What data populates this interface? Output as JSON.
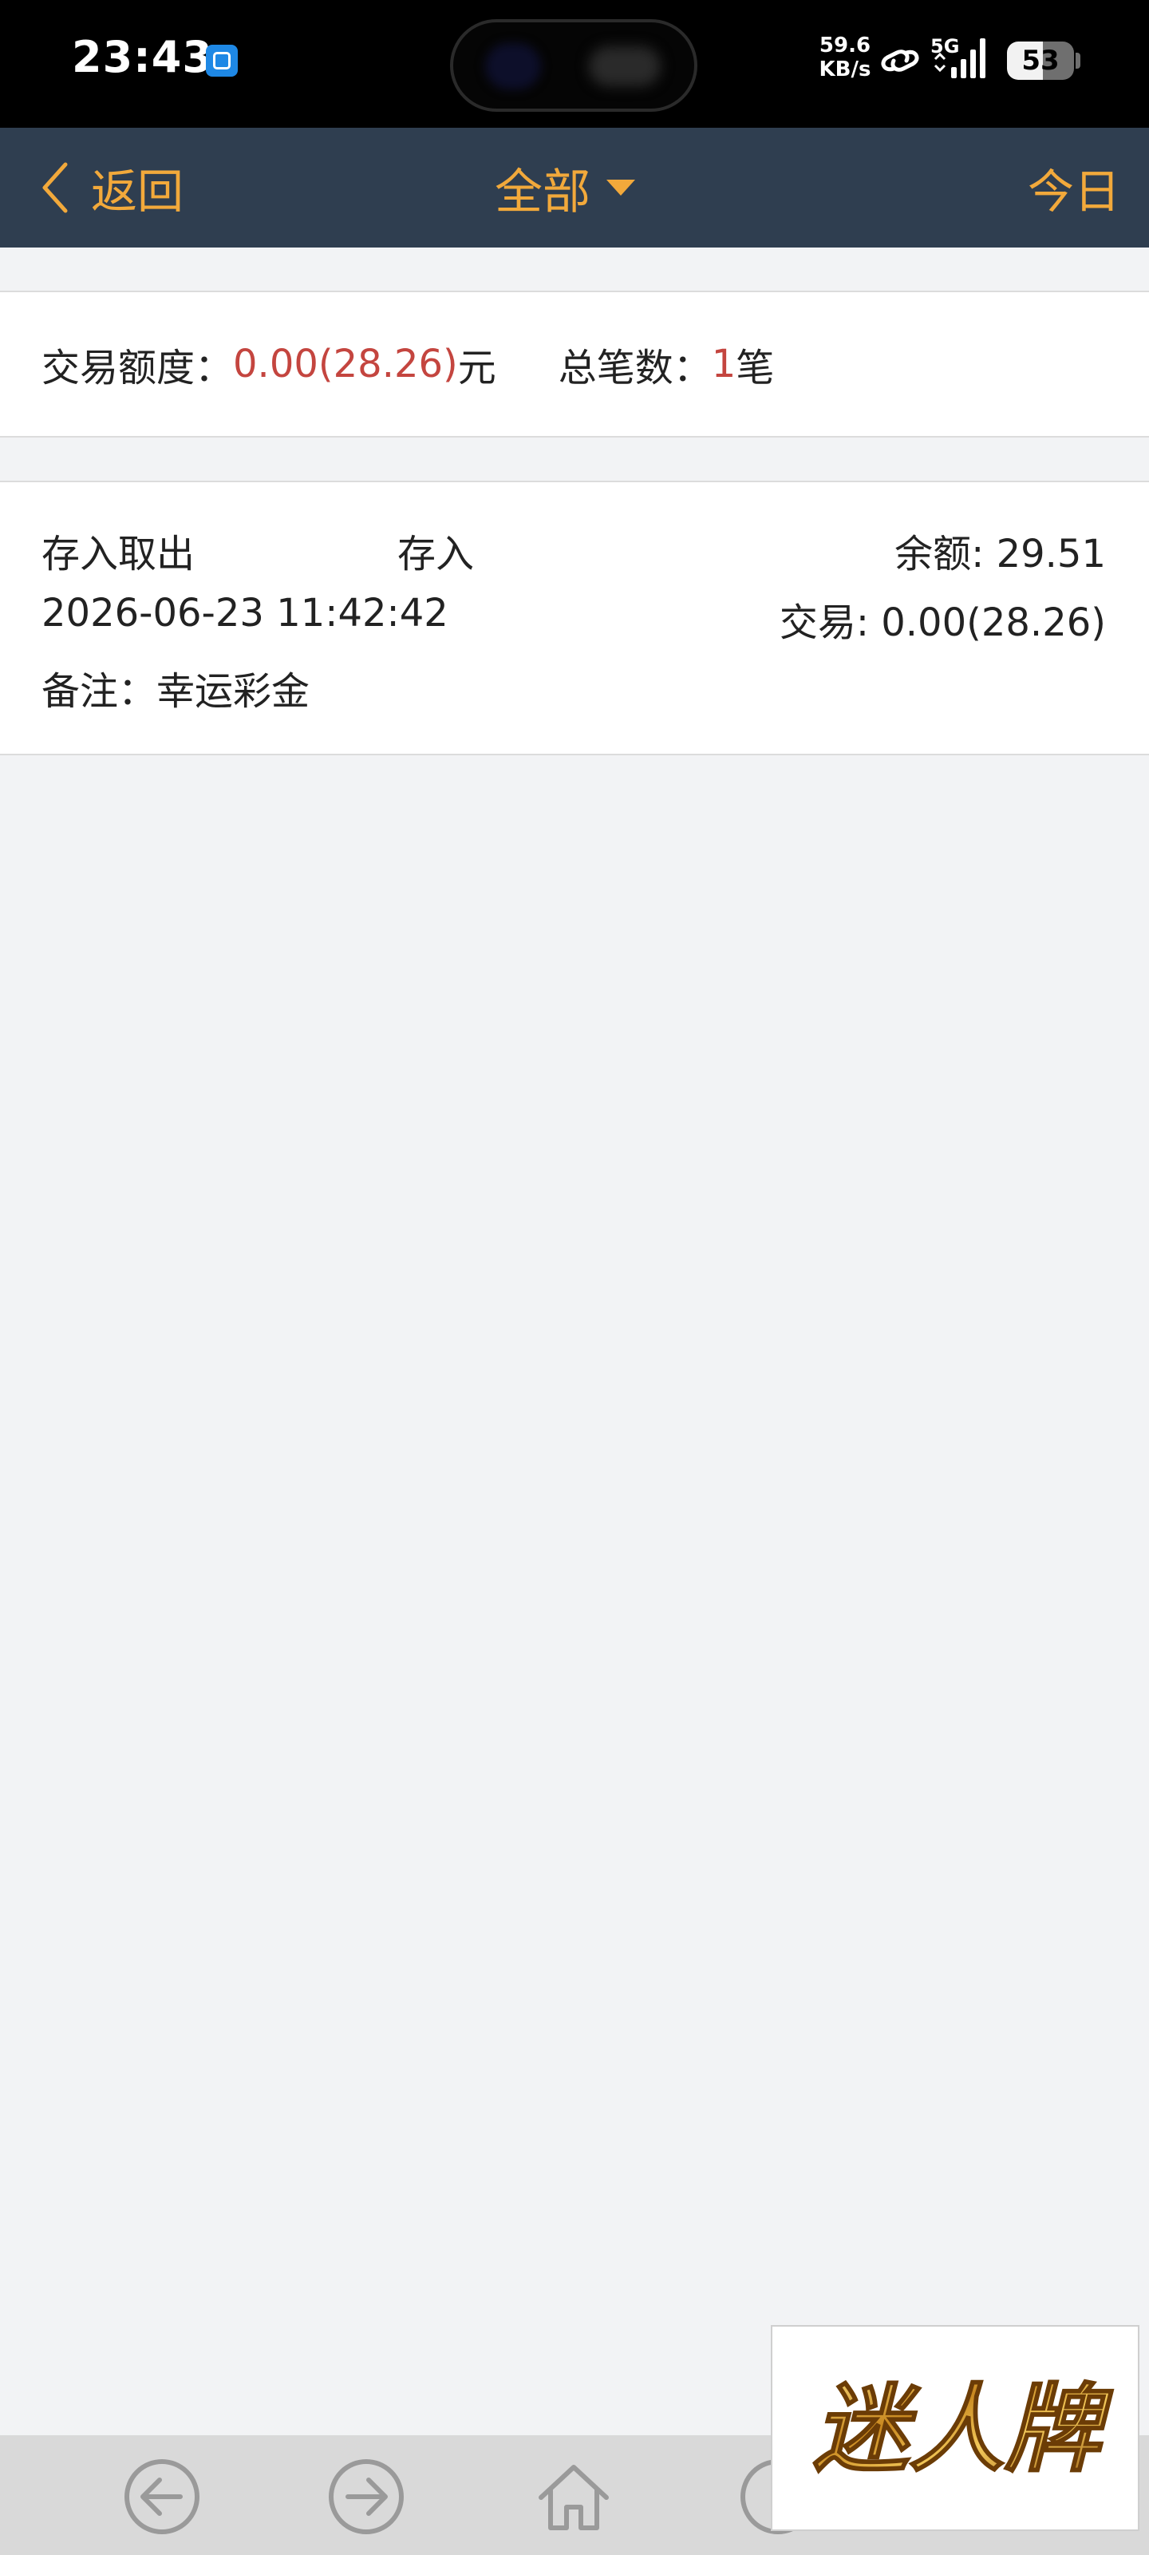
{
  "status_bar": {
    "time": "23:43",
    "net_speed_value": "59.6",
    "net_speed_unit": "KB/s",
    "network": "5G",
    "battery": "53",
    "battery_level": 0.53
  },
  "header": {
    "back_label": "返回",
    "filter_label": "全部",
    "today_label": "今日",
    "color": "#f2a93b",
    "background": "#2f3e50"
  },
  "summary": {
    "amount_label": "交易额度：",
    "amount_value": "0.00(28.26)",
    "amount_unit": "元",
    "count_label": "总笔数：",
    "count_value": "1",
    "count_unit": "笔",
    "highlight_color": "#c4453f"
  },
  "records": [
    {
      "type": "存入取出",
      "kind": "存入",
      "balance_label": "余额: ",
      "balance": "29.51",
      "time": "2026-06-23 11:42:42",
      "amount_label": "交易: ",
      "amount": "0.00(28.26)",
      "note_label": "备注：",
      "note": "幸运彩金"
    }
  ],
  "bottom_nav": {
    "icons": [
      "arrow-left-circle-icon",
      "arrow-right-circle-icon",
      "home-icon",
      "circle-icon"
    ]
  },
  "watermark": {
    "text": "迷人牌"
  }
}
